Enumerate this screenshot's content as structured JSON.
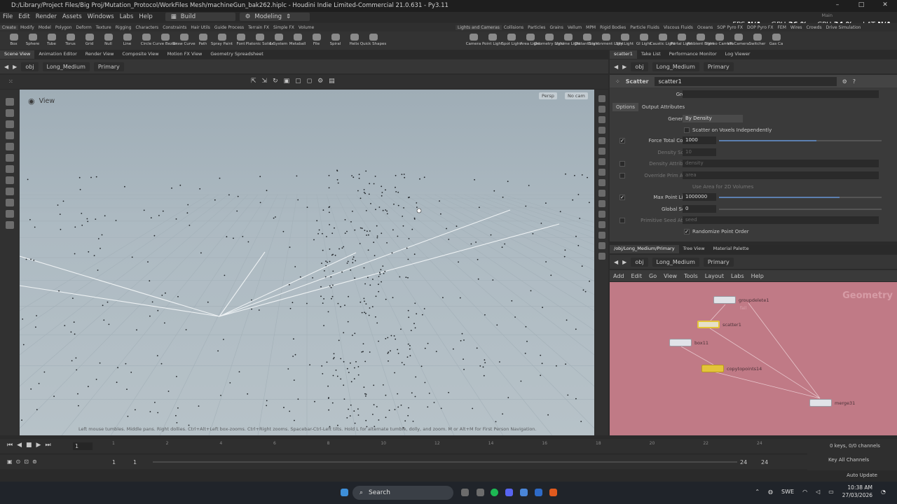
{
  "titlebar": {
    "title": "D:/Library/Project Files/Big Proj/Mutation_Protocol/WorkFiles Mesh/machineGun_bak262.hiplc - Houdini Indie Limited-Commercial 21.0.631 - Py3.11",
    "main_label": "Main",
    "perf": {
      "fps_label": "FPS",
      "fps_value": "N/A",
      "gpu_label": "GPU",
      "gpu_value": "36 %",
      "cpu_label": "CPU",
      "cpu_value": "34 %",
      "lat_label": "LAT",
      "lat_value": "N/A"
    }
  },
  "menubar": {
    "items": [
      "File",
      "Edit",
      "Render",
      "Assets",
      "Windows",
      "Labs",
      "Help"
    ],
    "desktop_build": "Build",
    "desktop_modeling": "Modeling"
  },
  "shelf_tabs_left": [
    "Create",
    "Modify",
    "Model",
    "Polygon",
    "Deform",
    "Texture",
    "Rigging",
    "Characters",
    "Constraints",
    "Hair Utils",
    "Guide Process",
    "Terrain FX",
    "Simple FX",
    "Volume"
  ],
  "shelf_tabs_right": [
    "Lights and Cameras",
    "Collisions",
    "Particles",
    "Grains",
    "Vellum",
    "MPM",
    "Rigid Bodies",
    "Particle Fluids",
    "Viscous Fluids",
    "Oceans",
    "SOP Pyro FX",
    "DOP Pyro FX",
    "FEM",
    "Wires",
    "Crowds",
    "Drive Simulation"
  ],
  "shelf_tools_left": [
    "Box",
    "Sphere",
    "Tube",
    "Torus",
    "Grid",
    "Null",
    "Line",
    "Circle",
    "Curve Bezier",
    "Draw Curve",
    "Path",
    "Spray Paint",
    "Font",
    "Platonic Solids",
    "L-System",
    "Metaball",
    "File",
    "Spiral",
    "Helix",
    "Quick Shapes"
  ],
  "shelf_tools_right": [
    "Camera",
    "Point Light",
    "Spot Light",
    "Area Light",
    "Geometry Light",
    "Volume Light",
    "Distant Light",
    "Environment Light",
    "Sky Light",
    "GI Light",
    "Caustic Light",
    "Portal Light",
    "Ambient Light",
    "Stereo Camera",
    "VR Camera",
    "Switcher",
    "Gas Ca"
  ],
  "pane_tabs_left": [
    "Scene View",
    "Animation Editor",
    "Render View",
    "Composite View",
    "Motion FX View",
    "Geometry Spreadsheet"
  ],
  "pane_tabs_right": [
    "scatter1",
    "Take List",
    "Performance Monitor",
    "Log Viewer"
  ],
  "path": {
    "obj": "obj",
    "node": "Long_Medium",
    "sub": "Primary"
  },
  "viewport": {
    "label": "View",
    "persp": "Persp",
    "cam": "No cam",
    "hint": "Left mouse tumbles. Middle pans. Right dollies. Ctrl+Alt+Left box-zooms. Ctrl+Right zooms. Spacebar-Ctrl-Left tilts. Hold L for alternate tumble, dolly, and zoom. M or Alt+M for First Person Navigation."
  },
  "params": {
    "type": "Scatter",
    "name": "scatter1",
    "group_label": "Group",
    "tabs": [
      "Options",
      "Output Attributes"
    ],
    "generate_label": "Generate",
    "generate_value": "By Density",
    "scatter_voxels": "Scatter on Voxels Independently",
    "force_total_label": "Force Total Count",
    "force_total_value": "1000",
    "force_total_fraction": 0.6,
    "density_scale_label": "Density Scale",
    "density_scale_value": "10",
    "density_attr_label": "Density Attribute",
    "density_attr_value": "density",
    "override_prim_label": "Override Prim Area",
    "override_prim_value": "area",
    "use_area": "Use Area for 2D Volumes",
    "max_point_label": "Max Point Limit",
    "max_point_value": "1000000",
    "max_point_fraction": 0.74,
    "global_seed_label": "Global Seed",
    "global_seed_value": "0",
    "prim_seed_label": "Primitive Seed Attr...",
    "prim_seed_value": "seed",
    "randomize_label": "Randomize Point Order"
  },
  "network": {
    "tabs": [
      "/obj/Long_Medium/Primary",
      "Tree View",
      "Material Palette"
    ],
    "menu": [
      "Add",
      "Edit",
      "Go",
      "View",
      "Tools",
      "Layout",
      "Labs",
      "Help"
    ],
    "context": "Geometry",
    "nodes": [
      {
        "name": "groupdelete1",
        "sub": "fail",
        "color": "#e1e3e8"
      },
      {
        "name": "scatter1",
        "sub": "",
        "color": "#e6e1c9"
      },
      {
        "name": "box11",
        "sub": "",
        "color": "#e1e3e8"
      },
      {
        "name": "copytopoints14",
        "sub": "",
        "color": "#e3c43a"
      },
      {
        "name": "merge31",
        "sub": "",
        "color": "#e1e3e8"
      }
    ]
  },
  "timeline": {
    "current_frame": "1",
    "ticks": [
      "1",
      "2",
      "4",
      "6",
      "8",
      "10",
      "12",
      "14",
      "16",
      "18",
      "20",
      "22",
      "24"
    ],
    "range_start": "1",
    "range_start2": "1",
    "range_end": "24",
    "range_end2": "24",
    "keys_status": "0 keys, 0/0 channels",
    "key_all": "Key All Channels",
    "auto_update": "Auto Update"
  },
  "taskbar": {
    "search": "Search",
    "lang": "SWE",
    "time": "10:38 AM",
    "date": "27/03/2026"
  }
}
